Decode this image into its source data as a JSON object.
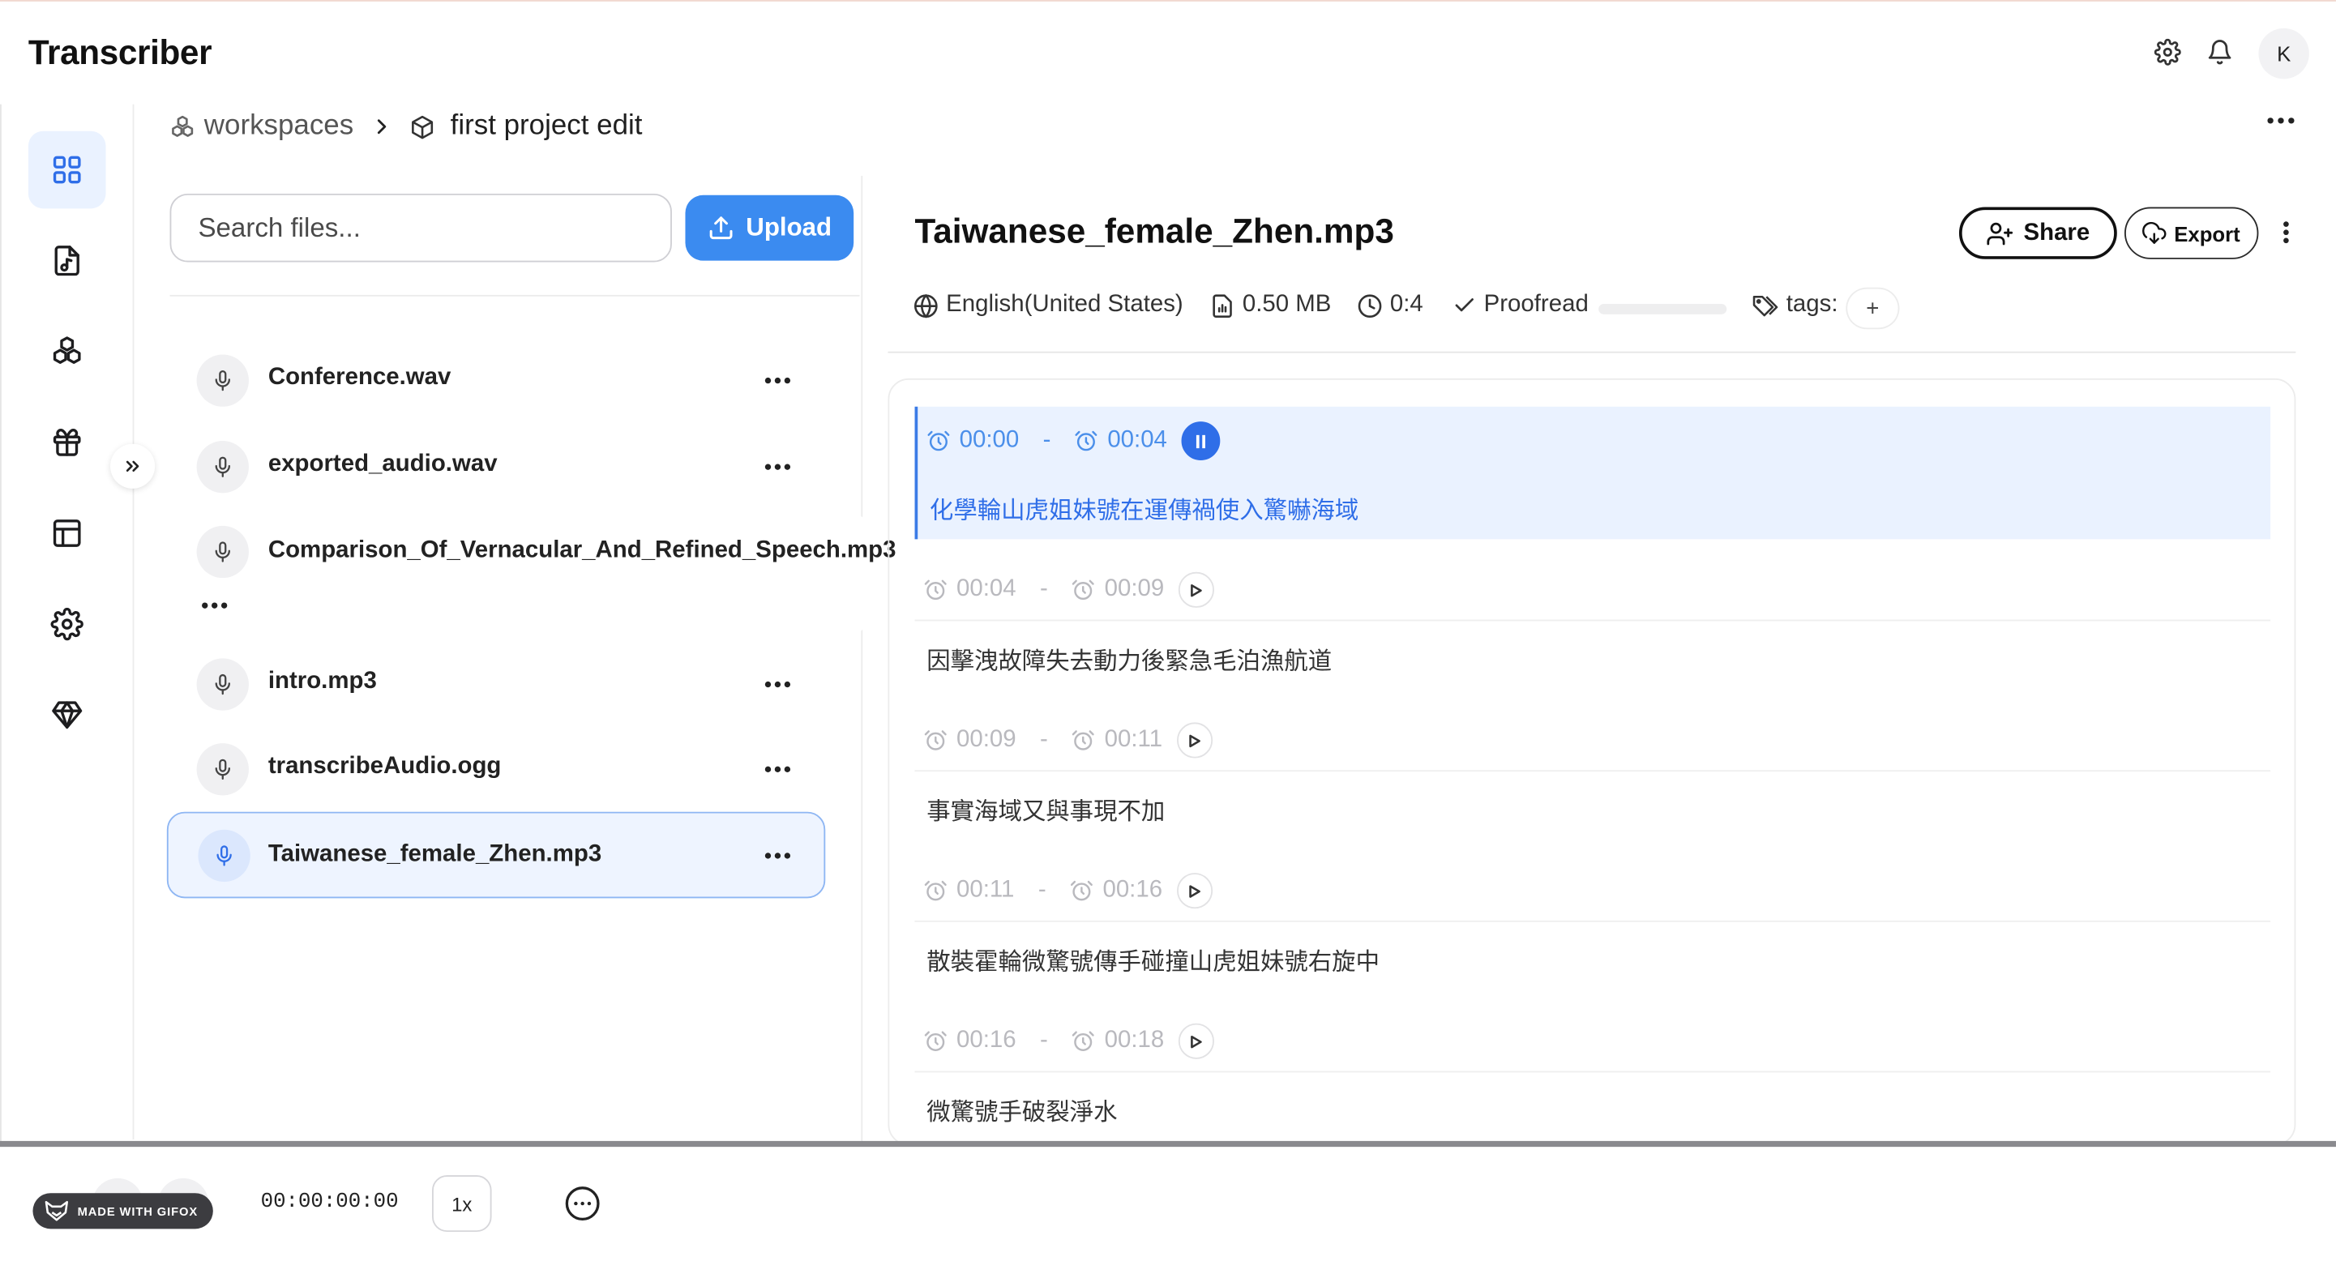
{
  "app": {
    "title": "Transcriber",
    "avatar_initial": "K"
  },
  "header_icons": [
    "gear-icon",
    "bell-icon"
  ],
  "breadcrumb": {
    "workspace": "workspaces",
    "project": "first project edit"
  },
  "sidebar": {
    "items": [
      {
        "icon": "grid-icon",
        "active": true
      },
      {
        "icon": "audio-file-icon",
        "active": false
      },
      {
        "icon": "cubes-icon",
        "active": false
      },
      {
        "icon": "gift-icon",
        "active": false
      },
      {
        "icon": "layout-icon",
        "active": false
      },
      {
        "icon": "settings-icon",
        "active": false
      },
      {
        "icon": "diamond-icon",
        "active": false
      }
    ]
  },
  "files": {
    "search_placeholder": "Search files...",
    "upload_label": "Upload",
    "items": [
      {
        "name": "Conference.wav"
      },
      {
        "name": "exported_audio.wav"
      },
      {
        "name": "Comparison_Of_Vernacular_And_Refined_Speech.mp3"
      },
      {
        "name": "intro.mp3"
      },
      {
        "name": "transcribeAudio.ogg"
      },
      {
        "name": "Taiwanese_female_Zhen.mp3",
        "selected": true
      }
    ]
  },
  "detail": {
    "title": "Taiwanese_female_Zhen.mp3",
    "share_label": "Share",
    "export_label": "Export",
    "language": "English(United States)",
    "size": "0.50 MB",
    "duration": "0:4",
    "proofread_label": "Proofread",
    "proofread_progress": 0,
    "tags_label": "tags:",
    "tag_add": "+"
  },
  "segments": [
    {
      "start": "00:00",
      "end": "00:04",
      "text": "化學輪山虎姐妹號在運傳禍使入驚嚇海域",
      "active": true
    },
    {
      "start": "00:04",
      "end": "00:09",
      "text": "因擊洩故障失去動力後緊急毛泊漁航道",
      "active": false
    },
    {
      "start": "00:09",
      "end": "00:11",
      "text": "事實海域又與事現不加",
      "active": false
    },
    {
      "start": "00:11",
      "end": "00:16",
      "text": "散裝霍輪微驚號傳手碰撞山虎姐妹號右旋中",
      "active": false
    },
    {
      "start": "00:16",
      "end": "00:18",
      "text": "微驚號手破裂淨水",
      "active": false
    }
  ],
  "segment_dash": "-",
  "player": {
    "time": "00:00:00:00",
    "speed": "1x"
  },
  "watermark": {
    "text": "MADE WITH GIFOX"
  },
  "colors": {
    "accent": "#3b8bf0",
    "active_bg": "#eaf2ff",
    "text": "#1a1a1a"
  }
}
